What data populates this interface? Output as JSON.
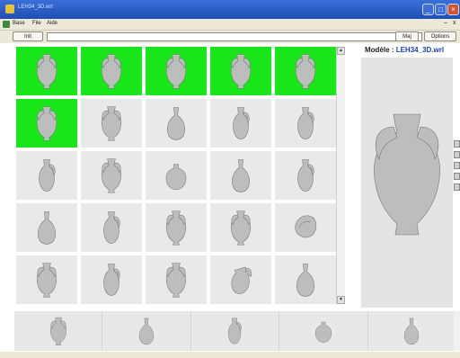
{
  "window": {
    "title": "LEH34_3D.wrl"
  },
  "menu": {
    "items": [
      "Base",
      "File",
      "Aide"
    ]
  },
  "toolbar": {
    "left_button": "Init",
    "right_buttons": [
      "Maj",
      "Options"
    ]
  },
  "model": {
    "label": "Modèle :",
    "file": "LEH34_3D.wrl"
  },
  "grid": {
    "rows": [
      [
        {
          "icon": "amphora-icon",
          "selected": true
        },
        {
          "icon": "amphora-icon",
          "selected": true
        },
        {
          "icon": "amphora-icon",
          "selected": true
        },
        {
          "icon": "amphora-icon",
          "selected": true
        },
        {
          "icon": "amphora-icon",
          "selected": true
        }
      ],
      [
        {
          "icon": "amphora-icon",
          "selected": true
        },
        {
          "icon": "amphora-icon",
          "selected": false
        },
        {
          "icon": "vase-icon",
          "selected": false
        },
        {
          "icon": "jug-icon",
          "selected": false
        },
        {
          "icon": "jug-icon",
          "selected": false
        }
      ],
      [
        {
          "icon": "jug-icon",
          "selected": false
        },
        {
          "icon": "amphora-icon",
          "selected": false
        },
        {
          "icon": "round-pot-icon",
          "selected": false
        },
        {
          "icon": "vase-icon",
          "selected": false
        },
        {
          "icon": "jug-icon",
          "selected": false
        }
      ],
      [
        {
          "icon": "vase-icon",
          "selected": false
        },
        {
          "icon": "jug-icon",
          "selected": false
        },
        {
          "icon": "amphora-icon",
          "selected": false
        },
        {
          "icon": "amphora-icon",
          "selected": false
        },
        {
          "icon": "shell-fragment-icon",
          "selected": false
        }
      ],
      [
        {
          "icon": "amphora-icon",
          "selected": false
        },
        {
          "icon": "jug-icon",
          "selected": false
        },
        {
          "icon": "amphora-icon",
          "selected": false
        },
        {
          "icon": "broken-jug-icon",
          "selected": false
        },
        {
          "icon": "vase-icon",
          "selected": false
        }
      ]
    ]
  },
  "bottom_strip": {
    "items": [
      "amphora-icon",
      "vase-icon",
      "jug-icon",
      "round-pot-icon",
      "vase-icon"
    ]
  },
  "colors": {
    "selected": "#19e619",
    "titlebar": "#2a5bc4",
    "model_file": "#1f3fb8"
  }
}
